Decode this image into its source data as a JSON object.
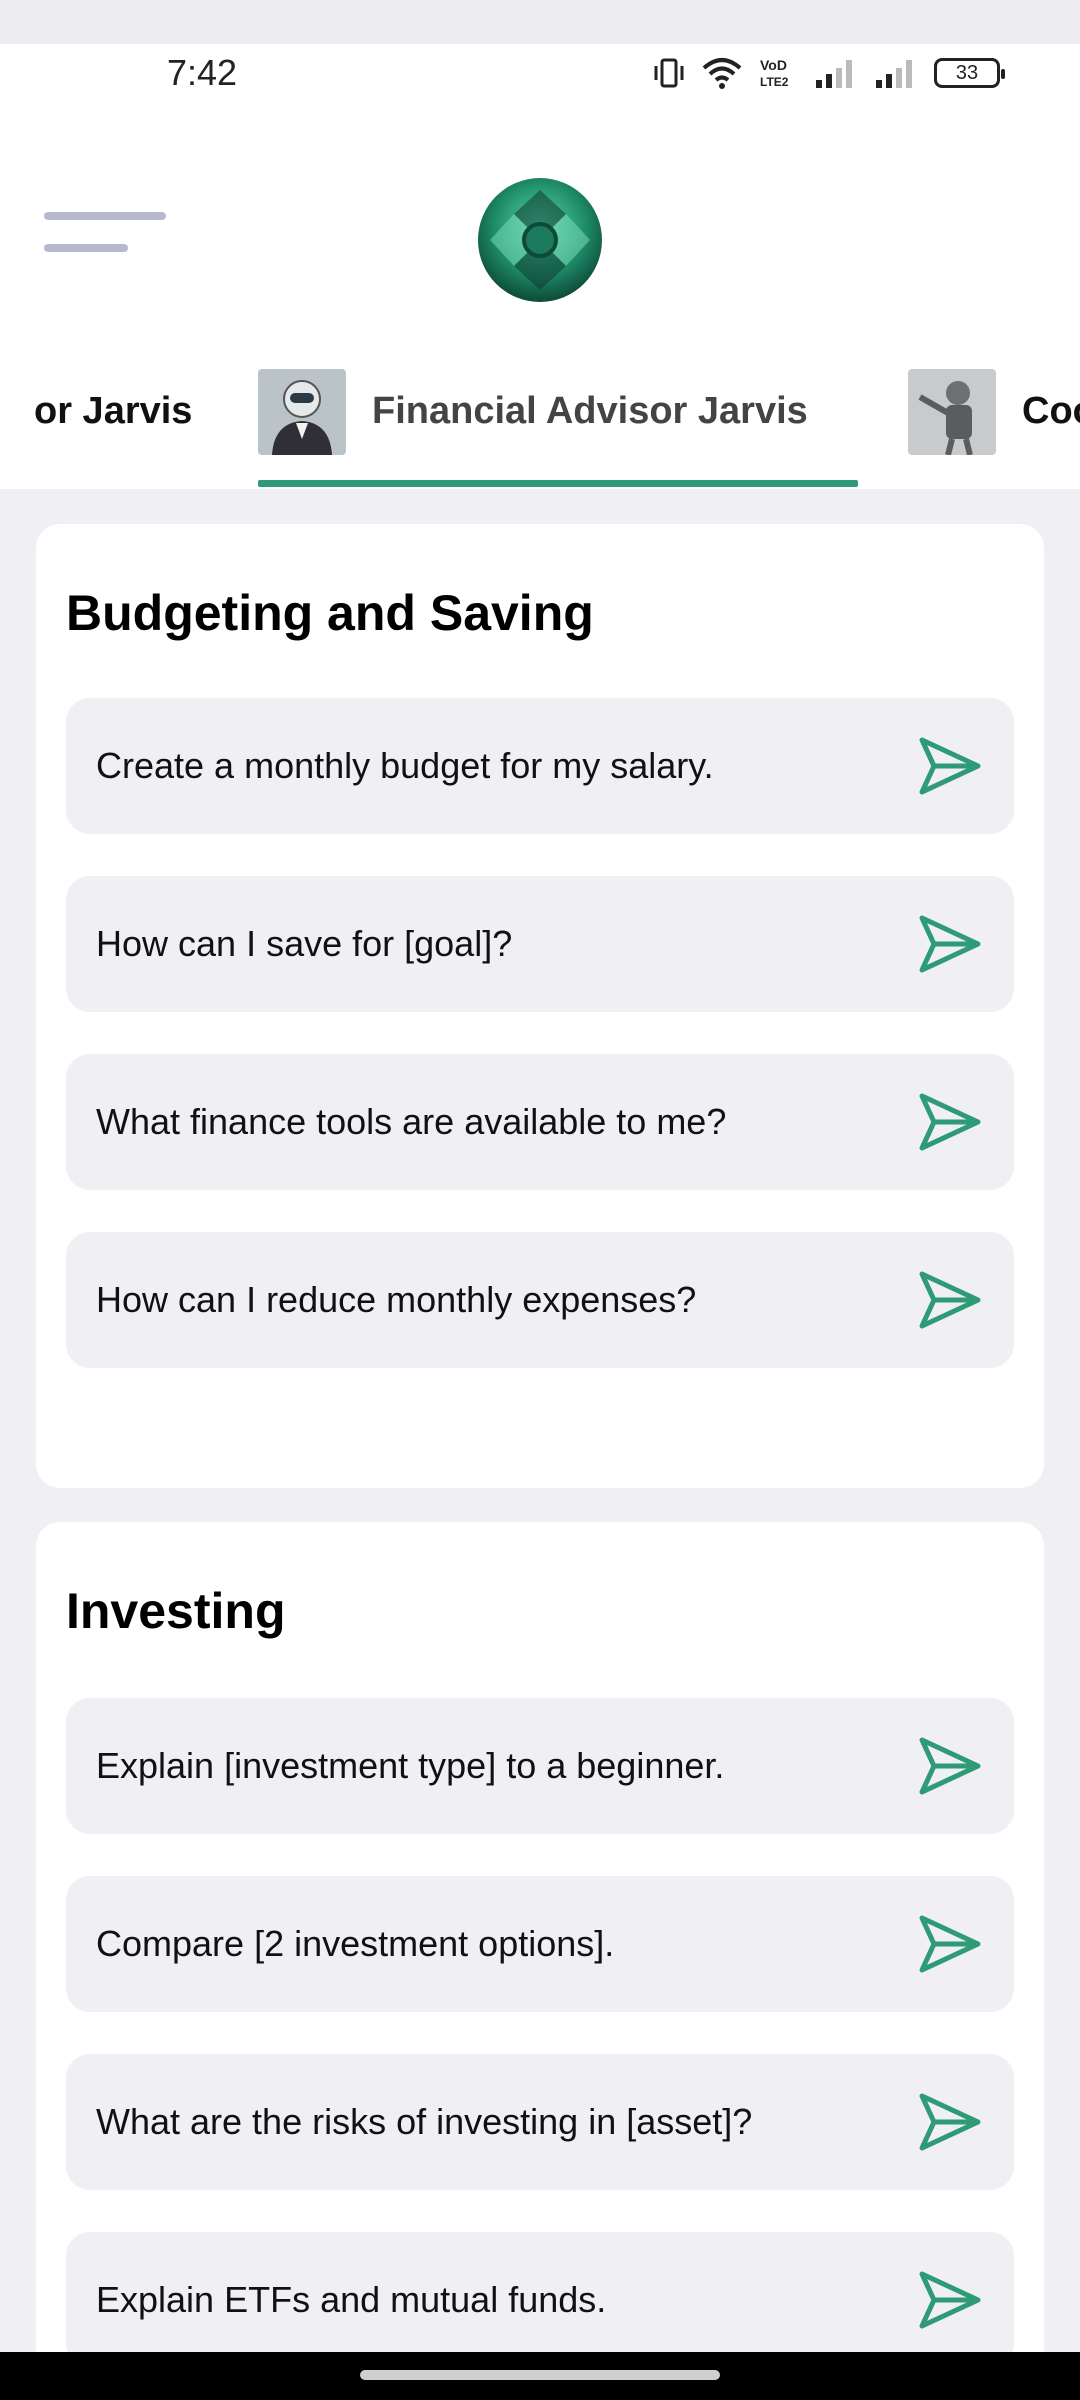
{
  "status_bar": {
    "time": "7:42",
    "battery": "33",
    "icons": [
      "vibrate-icon",
      "wifi-icon",
      "volte-icon",
      "signal-icon",
      "signal-icon",
      "battery-icon"
    ]
  },
  "header": {
    "menu_icon": "menu-icon",
    "logo": "app-logo"
  },
  "tabs": [
    {
      "label": "or Jarvis"
    },
    {
      "label": "Financial Advisor Jarvis",
      "active": true
    },
    {
      "label": "Coo"
    }
  ],
  "sections": [
    {
      "title": "Budgeting and Saving",
      "prompts": [
        "Create a monthly budget for my salary.",
        "How can I save for [goal]?",
        "What finance tools are available to me?",
        "How can I reduce monthly expenses?"
      ]
    },
    {
      "title": "Investing",
      "prompts": [
        "Explain [investment type] to a beginner.",
        "Compare [2 investment options].",
        "What are the risks of investing in [asset]?",
        "Explain ETFs and mutual funds."
      ]
    }
  ],
  "colors": {
    "accent": "#2e9a76",
    "prompt_bg": "#efeff4",
    "page_bg": "#efeff4"
  }
}
